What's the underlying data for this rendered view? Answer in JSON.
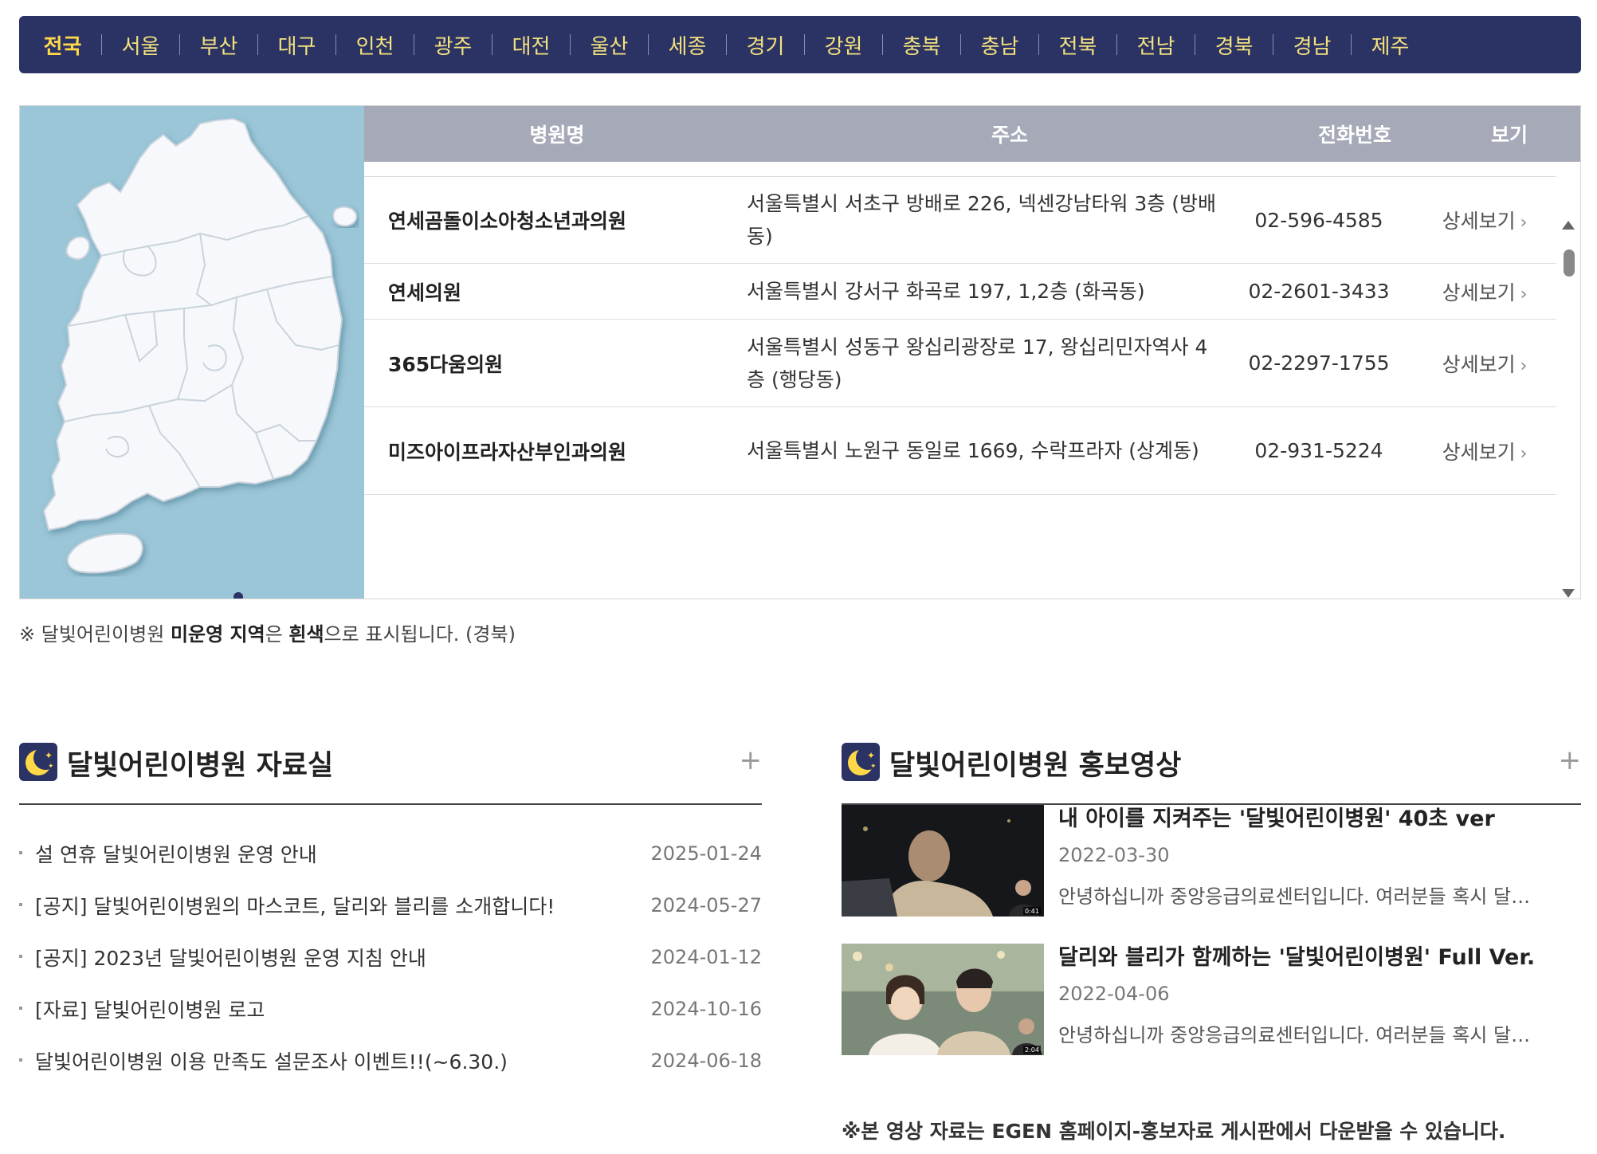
{
  "regions": [
    "전국",
    "서울",
    "부산",
    "대구",
    "인천",
    "광주",
    "대전",
    "울산",
    "세종",
    "경기",
    "강원",
    "충북",
    "충남",
    "전북",
    "전남",
    "경북",
    "경남",
    "제주"
  ],
  "active_region": "전국",
  "table": {
    "headers": {
      "name": "병원명",
      "address": "주소",
      "phone": "전화번호",
      "view": "보기"
    },
    "rows": [
      {
        "name": "연세곰돌이소아청소년과의원",
        "address": "서울특별시 서초구 방배로 226, 넥센강남타워 3층 (방배동)",
        "phone": "02-596-4585",
        "view": "상세보기"
      },
      {
        "name": "연세의원",
        "address": "서울특별시 강서구 화곡로 197, 1,2층 (화곡동)",
        "phone": "02-2601-3433",
        "view": "상세보기"
      },
      {
        "name": "365다움의원",
        "address": "서울특별시 성동구 왕십리광장로 17, 왕십리민자역사 4층 (행당동)",
        "phone": "02-2297-1755",
        "view": "상세보기"
      },
      {
        "name": "미즈아이프라자산부인과의원",
        "address": "서울특별시 노원구 동일로 1669, 수락프라자 (상계동)",
        "phone": "02-931-5224",
        "view": "상세보기"
      }
    ]
  },
  "map_note": {
    "prefix": "※ 달빛어린이병원 ",
    "bold1": "미운영 지역",
    "mid": "은 ",
    "bold2": "흰색",
    "suffix": "으로 표시됩니다. (경북)"
  },
  "resources": {
    "title": "달빛어린이병원 자료실",
    "more": "+",
    "items": [
      {
        "title": "설 연휴 달빛어린이병원 운영 안내",
        "date": "2025-01-24"
      },
      {
        "title": "[공지] 달빛어린이병원의 마스코트, 달리와 블리를 소개합니다!",
        "date": "2024-05-27"
      },
      {
        "title": "[공지] 2023년 달빛어린이병원 운영 지침 안내",
        "date": "2024-01-12"
      },
      {
        "title": "[자료] 달빛어린이병원 로고",
        "date": "2024-10-16"
      },
      {
        "title": "달빛어린이병원 이용 만족도 설문조사 이벤트!!(~6.30.)",
        "date": "2024-06-18"
      }
    ]
  },
  "videos": {
    "title": "달빛어린이병원 홍보영상",
    "more": "+",
    "items": [
      {
        "title": "내 아이를 지켜주는 '달빛어린이병원' 40초 ver",
        "date": "2022-03-30",
        "desc": "안녕하십니까 중앙응급의료센터입니다. 여러분들 혹시 달빛어린이병원을 아시나요?",
        "duration": "0:41"
      },
      {
        "title": "달리와 블리가 함께하는 '달빛어린이병원' Full Ver.",
        "date": "2022-04-06",
        "desc": "안녕하십니까 중앙응급의료센터입니다. 여러분들 혹시 달빛어린이병원을 아시나요?",
        "duration": "2:04"
      }
    ],
    "footnote": "※본 영상 자료는 EGEN 홈페이지-홍보자료 게시판에서 다운받을 수 있습니다."
  }
}
